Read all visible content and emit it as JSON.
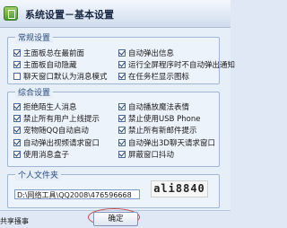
{
  "window": {
    "title": "系统设置－基本设置"
  },
  "general": {
    "label": "常规设置",
    "options": [
      {
        "label": "主面板总在最前面",
        "checked": true
      },
      {
        "label": "自动弹出信息",
        "checked": true
      },
      {
        "label": "主面板自动隐藏",
        "checked": true
      },
      {
        "label": "运行全屏程序时不自动弹出通知",
        "checked": true
      },
      {
        "label": "聊天窗口默认为消息模式",
        "checked": false
      },
      {
        "label": "在任务栏显示图标",
        "checked": true
      }
    ]
  },
  "combined": {
    "label": "综合设置",
    "options": [
      {
        "label": "拒绝陌生人消息",
        "checked": true
      },
      {
        "label": "自动播放魔法表情",
        "checked": true
      },
      {
        "label": "禁止所有用户上线提示",
        "checked": true
      },
      {
        "label": "禁止使用USB Phone",
        "checked": true
      },
      {
        "label": "宠物随QQ自动启动",
        "checked": true
      },
      {
        "label": "禁止所有新邮件提示",
        "checked": true
      },
      {
        "label": "自动弹出视频请求窗口",
        "checked": true
      },
      {
        "label": "自动弹出3D聊天请求窗口",
        "checked": true
      },
      {
        "label": "使用消息盒子",
        "checked": true
      },
      {
        "label": "屏蔽窗口抖动",
        "checked": true
      }
    ]
  },
  "personal_folder": {
    "label": "个人文件夹",
    "path": "D:\\网络工具\\QQ2008\\476596668"
  },
  "watermark": "ali8840",
  "footer": {
    "share_label": "共享搔事",
    "ok_label": "确定"
  }
}
